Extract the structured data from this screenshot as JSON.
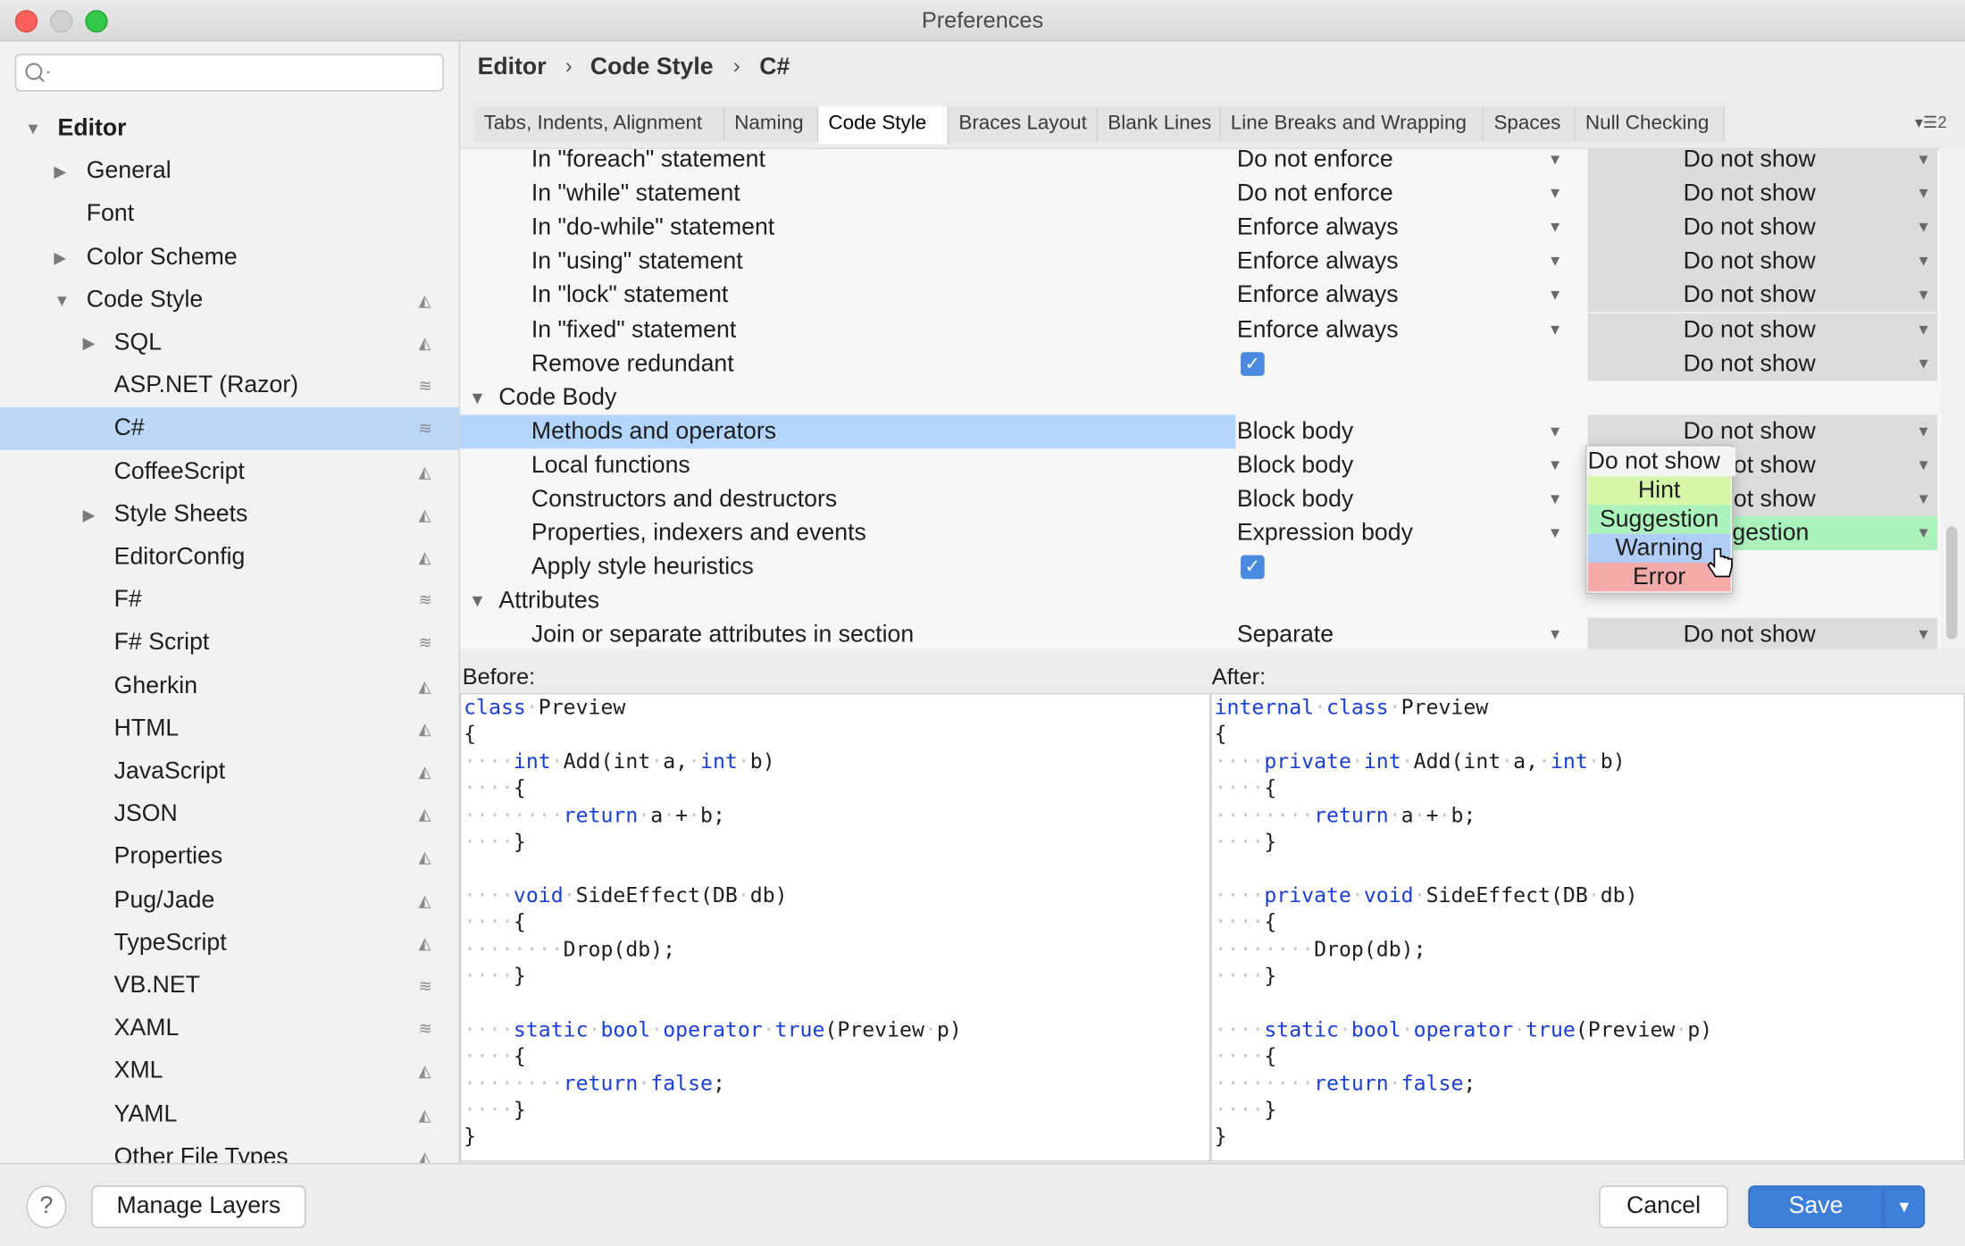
{
  "window": {
    "title": "Preferences"
  },
  "colors": {
    "accent": "#3d7fd9",
    "selection": "#bcd7f5",
    "hint": "#d6f7a8",
    "suggestion": "#abf2bd",
    "warning": "#b0cdf7",
    "error": "#f4aaa8"
  },
  "search": {
    "placeholder": "",
    "icon": "search-icon"
  },
  "sidebar": {
    "items": [
      {
        "label": "Editor",
        "level": 0,
        "arrow": "down",
        "bold": true
      },
      {
        "label": "General",
        "level": 1,
        "arrow": "right"
      },
      {
        "label": "Font",
        "level": 1
      },
      {
        "label": "Color Scheme",
        "level": 1,
        "arrow": "right"
      },
      {
        "label": "Code Style",
        "level": 1,
        "arrow": "down",
        "icon": "single"
      },
      {
        "label": "SQL",
        "level": 2,
        "arrow": "right",
        "icon": "single"
      },
      {
        "label": "ASP.NET (Razor)",
        "level": 2,
        "icon": "layers"
      },
      {
        "label": "C#",
        "level": 2,
        "icon": "layers",
        "selected": true
      },
      {
        "label": "CoffeeScript",
        "level": 2,
        "icon": "single"
      },
      {
        "label": "Style Sheets",
        "level": 2,
        "arrow": "right",
        "icon": "single"
      },
      {
        "label": "EditorConfig",
        "level": 2,
        "icon": "single"
      },
      {
        "label": "F#",
        "level": 2,
        "icon": "layers"
      },
      {
        "label": "F# Script",
        "level": 2,
        "icon": "layers"
      },
      {
        "label": "Gherkin",
        "level": 2,
        "icon": "single"
      },
      {
        "label": "HTML",
        "level": 2,
        "icon": "single"
      },
      {
        "label": "JavaScript",
        "level": 2,
        "icon": "single"
      },
      {
        "label": "JSON",
        "level": 2,
        "icon": "single"
      },
      {
        "label": "Properties",
        "level": 2,
        "icon": "single"
      },
      {
        "label": "Pug/Jade",
        "level": 2,
        "icon": "single"
      },
      {
        "label": "TypeScript",
        "level": 2,
        "icon": "single"
      },
      {
        "label": "VB.NET",
        "level": 2,
        "icon": "layers"
      },
      {
        "label": "XAML",
        "level": 2,
        "icon": "layers"
      },
      {
        "label": "XML",
        "level": 2,
        "icon": "single"
      },
      {
        "label": "YAML",
        "level": 2,
        "icon": "single"
      },
      {
        "label": "Other File Types",
        "level": 2,
        "icon": "single"
      }
    ]
  },
  "breadcrumb": [
    "Editor",
    "Code Style",
    "C#"
  ],
  "tabs": [
    {
      "label": "Tabs, Indents, Alignment"
    },
    {
      "label": "Naming"
    },
    {
      "label": "Code Style",
      "active": true
    },
    {
      "label": "Braces Layout"
    },
    {
      "label": "Blank Lines"
    },
    {
      "label": "Line Breaks and Wrapping"
    },
    {
      "label": "Spaces"
    },
    {
      "label": "Null Checking"
    }
  ],
  "tabs_overflow": "2",
  "rows": [
    {
      "label": "In \"foreach\" statement",
      "level": 2,
      "value": "Do not enforce",
      "severity": "Do not show"
    },
    {
      "label": "In \"while\" statement",
      "level": 2,
      "value": "Do not enforce",
      "severity": "Do not show"
    },
    {
      "label": "In \"do-while\" statement",
      "level": 2,
      "value": "Enforce always",
      "severity": "Do not show"
    },
    {
      "label": "In \"using\" statement",
      "level": 2,
      "value": "Enforce always",
      "severity": "Do not show"
    },
    {
      "label": "In \"lock\" statement",
      "level": 2,
      "value": "Enforce always",
      "severity": "Do not show"
    },
    {
      "label": "In \"fixed\" statement",
      "level": 2,
      "value": "Enforce always",
      "severity": "Do not show"
    },
    {
      "label": "Remove redundant",
      "level": 2,
      "checked": true,
      "severity": "Do not show"
    },
    {
      "label": "Code Body",
      "level": 1,
      "group": true
    },
    {
      "label": "Methods and operators",
      "level": 2,
      "value": "Block body",
      "severity": "Do not show",
      "selected": true
    },
    {
      "label": "Local functions",
      "level": 2,
      "value": "Block body",
      "severity": "Do not show"
    },
    {
      "label": "Constructors and destructors",
      "level": 2,
      "value": "Block body",
      "severity": "Do not show"
    },
    {
      "label": "Properties, indexers and events",
      "level": 2,
      "value": "Expression body",
      "severity": "Suggestion",
      "severity_color": "#abf2bd"
    },
    {
      "label": "Apply style heuristics",
      "level": 2,
      "checked": true
    },
    {
      "label": "Attributes",
      "level": 1,
      "group": true
    },
    {
      "label": "Join or separate attributes in section",
      "level": 2,
      "value": "Separate",
      "severity": "Do not show"
    }
  ],
  "severity_popup": {
    "options": [
      {
        "label": "Do not show",
        "color": "#f4f4f4"
      },
      {
        "label": "Hint",
        "color": "#d6f7a8"
      },
      {
        "label": "Suggestion",
        "color": "#abf2bd"
      },
      {
        "label": "Warning",
        "color": "#b0cdf7",
        "hovered": true
      },
      {
        "label": "Error",
        "color": "#f4aaa8"
      }
    ]
  },
  "preview": {
    "before_label": "Before:",
    "after_label": "After:",
    "keywords": [
      "class",
      "internal",
      "private",
      "int",
      "return",
      "void",
      "static",
      "bool",
      "operator",
      "true",
      "false"
    ],
    "before": [
      "class Preview",
      "{",
      "    int Add(int a, int b)",
      "    {",
      "        return a + b;",
      "    }",
      "",
      "    void SideEffect(DB db)",
      "    {",
      "        Drop(db);",
      "    }",
      "",
      "    static bool operator true(Preview p)",
      "    {",
      "        return false;",
      "    }",
      "}"
    ],
    "after": [
      "internal class Preview",
      "{",
      "    private int Add(int a, int b)",
      "    {",
      "        return a + b;",
      "    }",
      "",
      "    private void SideEffect(DB db)",
      "    {",
      "        Drop(db);",
      "    }",
      "",
      "    static bool operator true(Preview p)",
      "    {",
      "        return false;",
      "    }",
      "}"
    ]
  },
  "footer": {
    "help": "?",
    "manage_layers": "Manage Layers",
    "cancel": "Cancel",
    "save": "Save"
  }
}
